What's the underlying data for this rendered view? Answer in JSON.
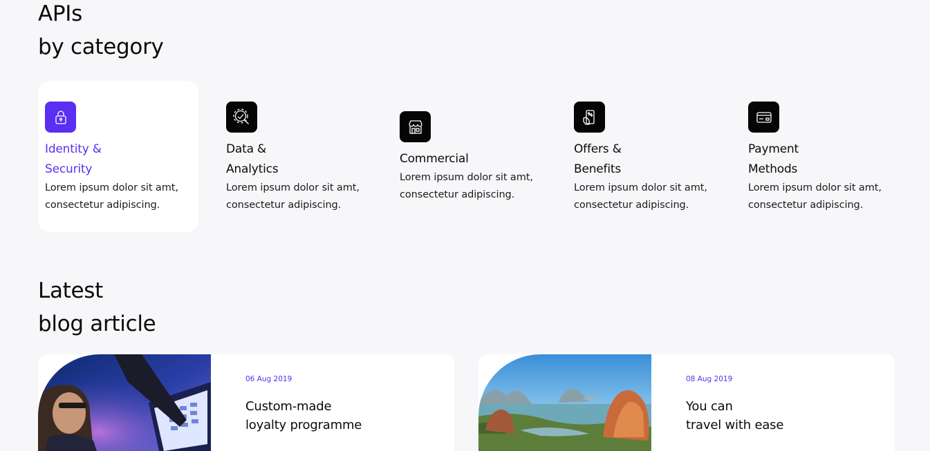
{
  "apis_section": {
    "title_line1": "APIs",
    "title_line2": "by category",
    "categories": [
      {
        "title": "Identity &\nSecurity",
        "description": "Lorem ipsum dolor sit amt, consectetur adipiscing.",
        "icon": "lock-icon",
        "active": true
      },
      {
        "title": "Data &\nAnalytics",
        "description": "Lorem ipsum dolor sit amt, consectetur adipiscing.",
        "icon": "analytics-icon",
        "active": false
      },
      {
        "title": "Commercial",
        "description": "Lorem ipsum dolor sit amt, consectetur adipiscing.",
        "icon": "store-icon",
        "active": false
      },
      {
        "title": "Offers &\nBenefits",
        "description": "Lorem ipsum dolor sit amt, consectetur adipiscing.",
        "icon": "offers-icon",
        "active": false
      },
      {
        "title": "Payment\nMethods",
        "description": "Lorem ipsum dolor sit amt, consectetur adipiscing.",
        "icon": "card-icon",
        "active": false
      }
    ]
  },
  "blog_section": {
    "title_line1": "Latest",
    "title_line2": "blog article",
    "articles": [
      {
        "date": "06 Aug 2019",
        "title": "Custom-made\nloyalty programme",
        "image": "person-at-screen-photo"
      },
      {
        "date": "08 Aug 2019",
        "title": "You can\ntravel with ease",
        "image": "bay-islands-landscape-photo"
      }
    ]
  },
  "colors": {
    "accent": "#5a2ff0",
    "background": "#f7f7fa",
    "card": "#ffffff",
    "icon_bg": "#050505"
  }
}
